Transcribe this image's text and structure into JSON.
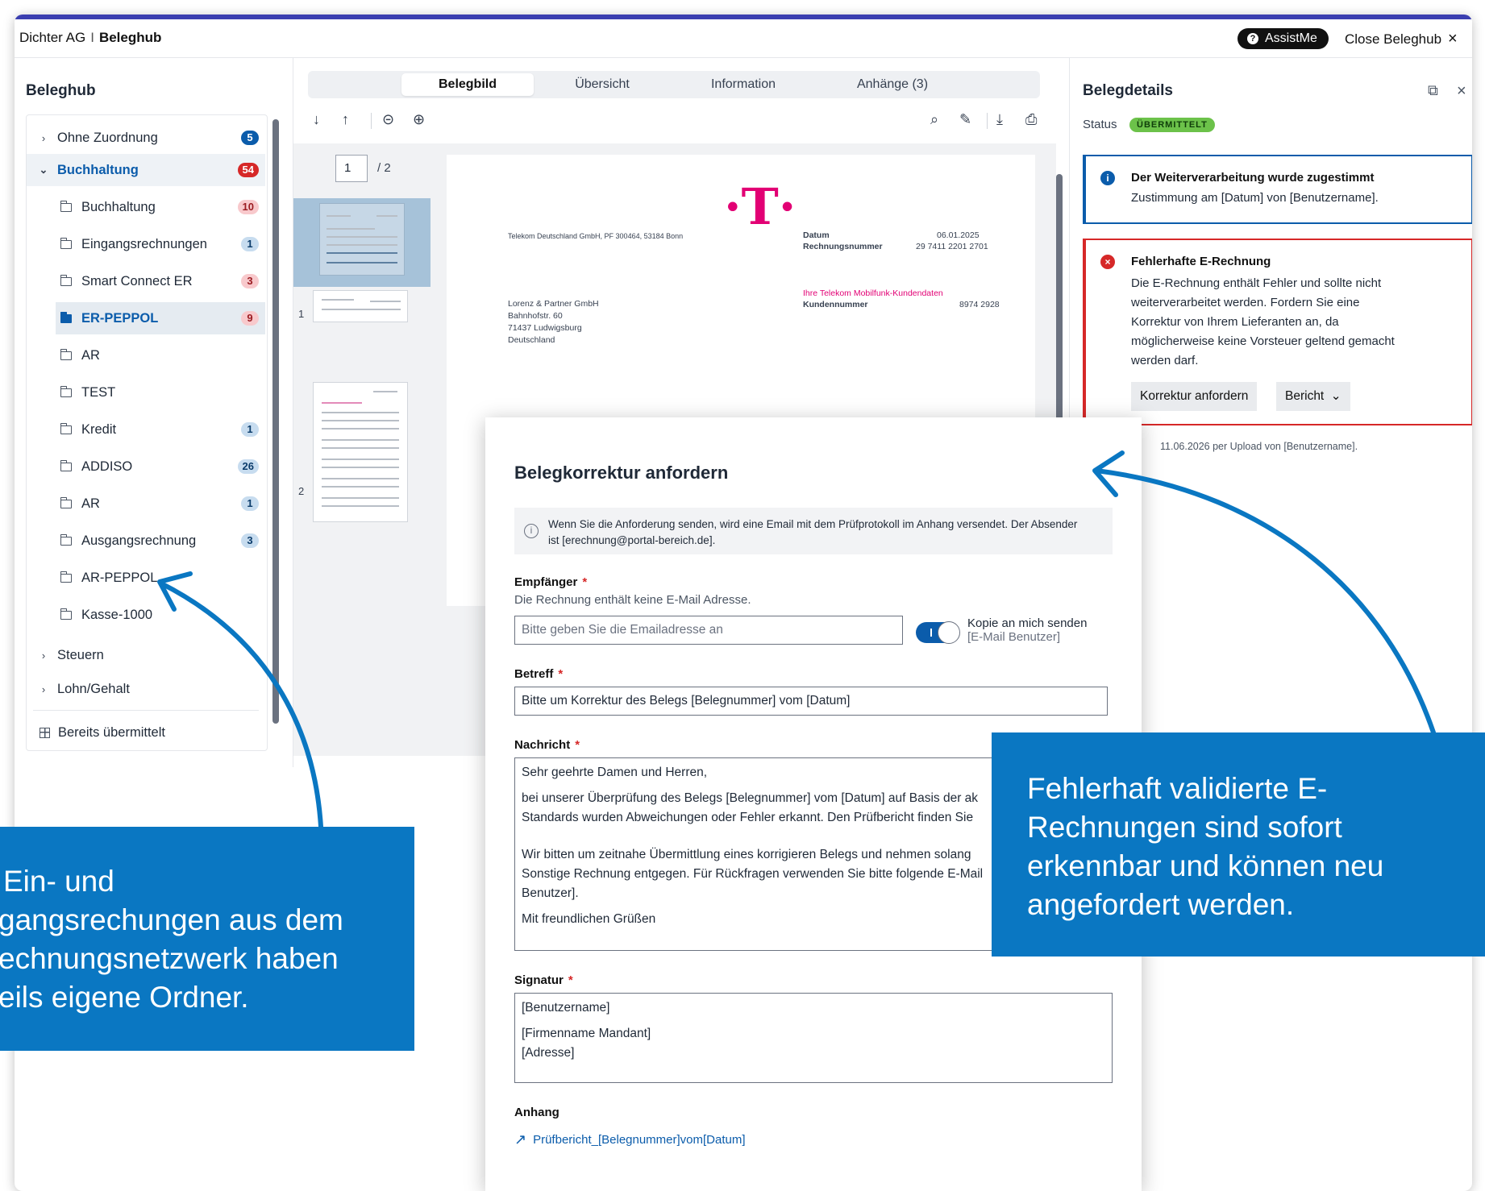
{
  "topbar": {
    "company": "Dichter AG",
    "separator": "I",
    "app": "Beleghub",
    "assist_label": "AssistMe",
    "close_label": "Close Beleghub"
  },
  "sidebar": {
    "title": "Beleghub",
    "items": [
      {
        "label": "Ohne Zuordnung",
        "badge": "5"
      },
      {
        "label": "Buchhaltung",
        "badge": "54"
      },
      {
        "label": "Buchhaltung",
        "badge": "10"
      },
      {
        "label": "Eingangsrechnungen",
        "badge": "1"
      },
      {
        "label": "Smart Connect ER",
        "badge": "3"
      },
      {
        "label": "ER-PEPPOL",
        "badge": "9"
      },
      {
        "label": "AR",
        "badge": ""
      },
      {
        "label": "TEST",
        "badge": ""
      },
      {
        "label": "Kredit",
        "badge": "1"
      },
      {
        "label": "ADDISO",
        "badge": "26"
      },
      {
        "label": "AR",
        "badge": "1"
      },
      {
        "label": "Ausgangsrechnung",
        "badge": "3"
      },
      {
        "label": "AR-PEPPOL",
        "badge": ""
      },
      {
        "label": "Kasse-1000",
        "badge": ""
      },
      {
        "label": "Steuern",
        "badge": ""
      },
      {
        "label": "Lohn/Gehalt",
        "badge": ""
      },
      {
        "label": "Bereits übermittelt",
        "badge": ""
      }
    ]
  },
  "tabs": [
    "Belegbild",
    "Übersicht",
    "Information",
    "Anhänge (3)"
  ],
  "viewer": {
    "page_current": "1",
    "page_total": "/ 2",
    "thumb_labels": [
      "1",
      "2"
    ],
    "invoice": {
      "sender_line": "Telekom Deutschland GmbH, PF 300464, 53184 Bonn",
      "datum_label": "Datum",
      "datum_value": "06.01.2025",
      "rn_label": "Rechnungsnummer",
      "rn_value": "29 7411 2201 2701",
      "recipient": [
        "Lorenz & Partner GmbH",
        "Bahnhofstr. 60",
        "71437 Ludwigsburg",
        "Deutschland"
      ],
      "kd_title": "Ihre Telekom Mobilfunk-Kundendaten",
      "kd_label": "Kundennummer",
      "kd_value": "8974 2928"
    }
  },
  "details": {
    "title": "Belegdetails",
    "status_label": "Status",
    "status_value": "ÜBERMITTELT",
    "info_title": "Der Weiterverarbeitung wurde zugestimmt",
    "info_text": "Zustimmung am [Datum] von [Benutzername].",
    "err_title": "Fehlerhafte E-Rechnung",
    "err_lines": [
      "Die E-Rechnung enthält Fehler und sollte nicht",
      "weiterverarbeitet werden. Fordern Sie eine",
      "Korrektur von Ihrem Lieferanten an, da",
      "möglicherweise keine Vorsteuer geltend gemacht",
      "werden darf."
    ],
    "btn_korrektur": "Korrektur anfordern",
    "btn_bericht": "Bericht",
    "meta": "11.06.2026 per Upload von [Benutzername]."
  },
  "modal": {
    "title": "Belegkorrektur anfordern",
    "note_lines": [
      "Wenn Sie die Anforderung senden, wird eine Email mit dem Prüfprotokoll im Anhang versendet. Der Absender",
      "ist [erechnung@portal-bereich.de]."
    ],
    "recipient_label": "Empfänger",
    "recipient_sub": "Die Rechnung enthält keine E-Mail Adresse.",
    "recipient_placeholder": "Bitte geben Sie die Emailadresse an",
    "copy_label": "Kopie an mich senden",
    "copy_sub": "[E-Mail Benutzer]",
    "subject_label": "Betreff",
    "subject_value": "Bitte um Korrektur des Belegs [Belegnummer] vom [Datum]",
    "message_label": "Nachricht",
    "message_lines": [
      "Sehr geehrte Damen und Herren,",
      "",
      "bei unserer Überprüfung des Belegs [Belegnummer] vom [Datum] auf Basis der ak",
      "Standards wurden Abweichungen oder Fehler erkannt. Den Prüfbericht finden Sie",
      "",
      "Wir bitten um zeitnahe Übermittlung eines korrigieren Belegs und nehmen solang",
      "Sonstige Rechnung entgegen. Für Rückfragen verwenden Sie bitte folgende E-Mail",
      "Benutzer].",
      "",
      "Mit freundlichen Grüßen"
    ],
    "signature_label": "Signatur",
    "signature_lines": [
      "[Benutzername]",
      "",
      "[Firmenname Mandant]",
      "[Adresse]"
    ],
    "attachment_label": "Anhang",
    "attachment_file": "Prüfbericht_[Belegnummer]vom[Datum]"
  },
  "callouts": {
    "left": [
      "Ein- und",
      "gangsrechungen aus dem",
      "echnungsnetzwerk haben",
      "eils eigene Ordner."
    ],
    "right": [
      "Fehlerhaft validierte E-",
      "Rechnungen sind sofort",
      "erkennbar und können neu",
      "angefordert werden."
    ]
  },
  "colors": {
    "accent": "#0b5cab",
    "callout": "#0a77c2",
    "error": "#d62828",
    "status_ok": "#6cc24a",
    "brand_magenta": "#e20074"
  }
}
